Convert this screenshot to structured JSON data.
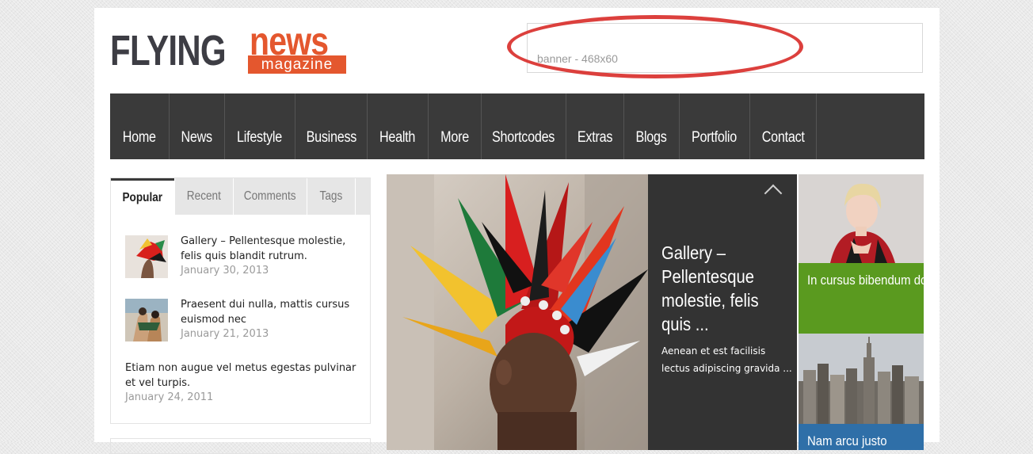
{
  "logo": {
    "word1": "FLYING",
    "word2": "news",
    "tagline": "magazine"
  },
  "banner": {
    "text": "banner - 468x60"
  },
  "nav": {
    "items": [
      {
        "label": "Home",
        "width": 75
      },
      {
        "label": "News",
        "width": 70
      },
      {
        "label": "Lifestyle",
        "width": 89
      },
      {
        "label": "Business",
        "width": 91
      },
      {
        "label": "Health",
        "width": 77
      },
      {
        "label": "More",
        "width": 67
      },
      {
        "label": "Shortcodes",
        "width": 107
      },
      {
        "label": "Extras",
        "width": 73
      },
      {
        "label": "Blogs",
        "width": 70
      },
      {
        "label": "Portfolio",
        "width": 89
      },
      {
        "label": "Contact",
        "width": 84
      }
    ]
  },
  "sidebar": {
    "tabs": [
      "Popular",
      "Recent",
      "Comments",
      "Tags"
    ],
    "posts": [
      {
        "title": "Gallery – Pellentesque molestie, felis quis blandit rutrum.",
        "date": "January 30, 2013"
      },
      {
        "title": "Praesent dui nulla, mattis cursus euismod nec",
        "date": "January 21, 2013"
      },
      {
        "title": "Etiam non augue vel metus egestas pulvinar et vel turpis.",
        "date": "January 24, 2011"
      }
    ]
  },
  "featured": {
    "title": "Gallery – Pellentesque molestie, felis quis ...",
    "excerpt": "Aenean et est facilisis lectus adipiscing gravida ..."
  },
  "side_cards": [
    {
      "caption": "In cursus bibendum dolor",
      "color": "#5a9a1f"
    },
    {
      "caption": "Nam arcu justo",
      "color": "#2f6fa8"
    }
  ]
}
